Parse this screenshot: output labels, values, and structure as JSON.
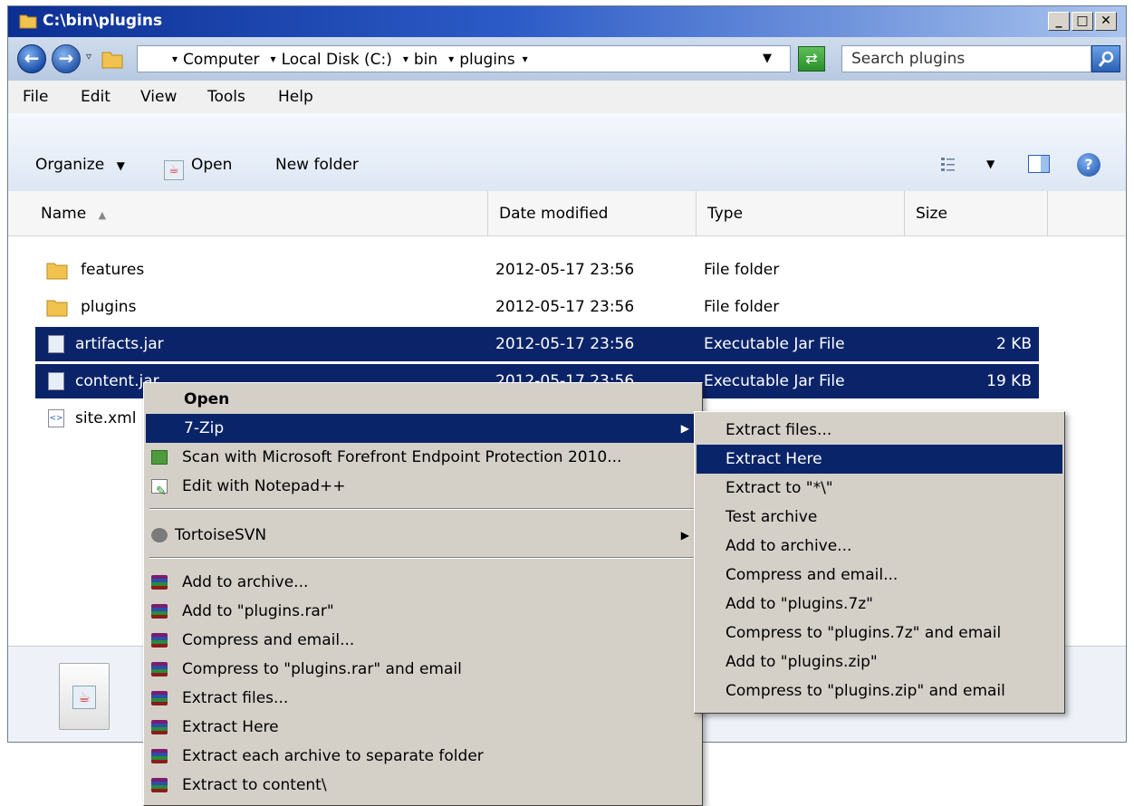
{
  "window": {
    "title": "C:\\bin\\plugins",
    "minimize_label": "_",
    "maximize_label": "□",
    "close_label": "✕"
  },
  "address": {
    "crumbs": [
      "Computer",
      "Local Disk (C:)",
      "bin",
      "plugins"
    ],
    "search_placeholder": "Search plugins"
  },
  "menubar": {
    "items": [
      "File",
      "Edit",
      "View",
      "Tools",
      "Help"
    ]
  },
  "toolbar": {
    "organize": "Organize",
    "open": "Open",
    "new_folder": "New folder"
  },
  "columns": {
    "name": "Name",
    "date": "Date modified",
    "type": "Type",
    "size": "Size"
  },
  "files": [
    {
      "name": "features",
      "date": "2012-05-17 23:56",
      "type": "File folder",
      "size": "",
      "icon": "folder-icon",
      "selected": false
    },
    {
      "name": "plugins",
      "date": "2012-05-17 23:56",
      "type": "File folder",
      "size": "",
      "icon": "folder-icon",
      "selected": false
    },
    {
      "name": "artifacts.jar",
      "date": "2012-05-17 23:56",
      "type": "Executable Jar File",
      "size": "2 KB",
      "icon": "jar-file-icon",
      "selected": true
    },
    {
      "name": "content.jar",
      "date": "2012-05-17 23:56",
      "type": "Executable Jar File",
      "size": "19 KB",
      "icon": "jar-file-icon",
      "selected": true
    },
    {
      "name": "site.xml",
      "date": "",
      "type": "",
      "size": "",
      "icon": "xml-file-icon",
      "selected": false
    }
  ],
  "context_menu": {
    "open": "Open",
    "seven_zip": "7-Zip",
    "scan": "Scan with Microsoft Forefront Endpoint Protection 2010...",
    "notepad": "Edit with Notepad++",
    "tortoise": "TortoiseSVN",
    "rar_items": [
      "Add to archive...",
      "Add to \"plugins.rar\"",
      "Compress and email...",
      "Compress to \"plugins.rar\" and email",
      "Extract files...",
      "Extract Here",
      "Extract each archive to separate folder",
      "Extract to content\\"
    ]
  },
  "submenu_7zip": {
    "items": [
      "Extract files...",
      "Extract Here",
      "Extract to \"*\\\"",
      "Test archive",
      "Add to archive...",
      "Compress and email...",
      "Add to \"plugins.7z\"",
      "Compress to \"plugins.7z\" and email",
      "Add to \"plugins.zip\"",
      "Compress to \"plugins.zip\" and email"
    ],
    "highlighted_index": 1
  },
  "colors": {
    "selection": "#0b2469",
    "menu_highlight": "#0a246a",
    "menu_bg": "#d4d0c8"
  }
}
